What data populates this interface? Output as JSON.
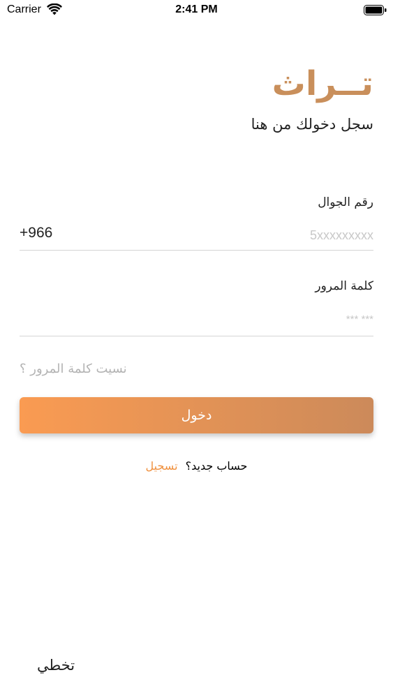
{
  "status_bar": {
    "carrier": "Carrier",
    "time": "2:41 PM",
    "wifi_icon": "wifi-icon",
    "battery_icon": "battery-icon"
  },
  "brand": {
    "logo_text": "تــراث",
    "subtitle": "سجل دخولك من هنا",
    "accent_color": "#c98f5b"
  },
  "phone_field": {
    "label": "رقم الجوال",
    "country_code": "+966",
    "placeholder": "5xxxxxxxxx",
    "value": ""
  },
  "password_field": {
    "label": "كلمة المرور",
    "placeholder": "*** ***",
    "value": ""
  },
  "forgot_password": "نسيت كلمة المرور ؟",
  "login_button": {
    "label": "دخول",
    "gradient_start": "#fa9b52",
    "gradient_end": "#cc8a5a"
  },
  "register": {
    "question": "حساب جديد؟",
    "link": "تسجيل",
    "link_color": "#f0913f"
  },
  "skip": "تخطي"
}
